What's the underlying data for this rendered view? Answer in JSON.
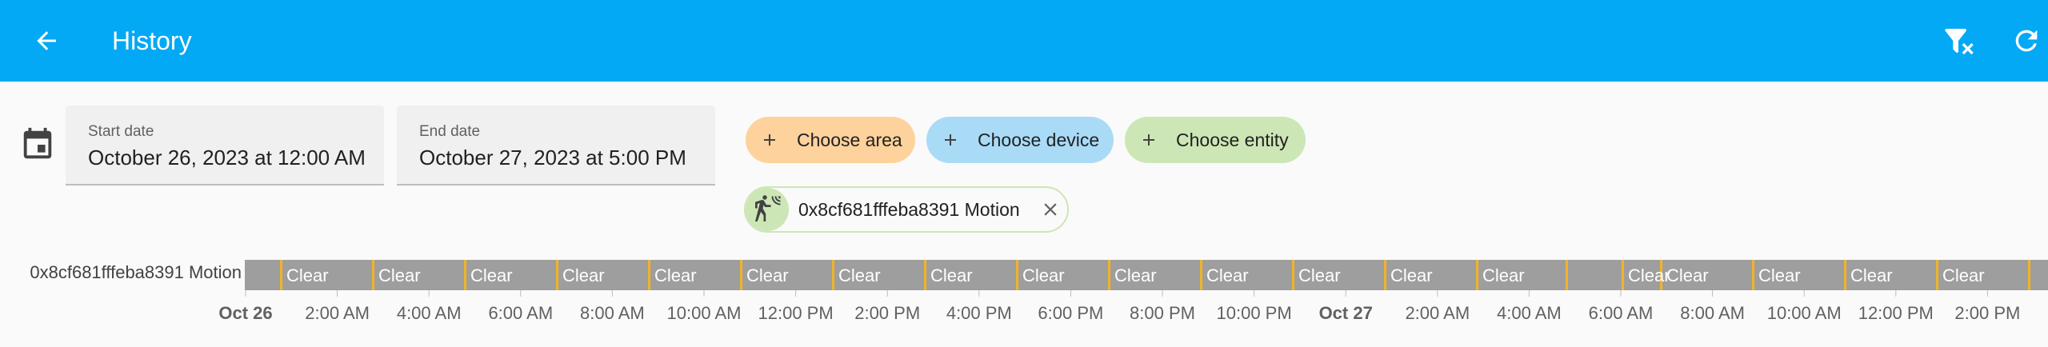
{
  "header": {
    "title": "History"
  },
  "filters": {
    "start_date": {
      "label": "Start date",
      "value": "October 26, 2023 at 12:00 AM"
    },
    "end_date": {
      "label": "End date",
      "value": "October 27, 2023 at 5:00 PM"
    }
  },
  "chips": {
    "area": "Choose area",
    "device": "Choose device",
    "entity": "Choose entity"
  },
  "selected_entity": {
    "name": "0x8cf681fffeba8391 Motion"
  },
  "timeline": {
    "entity_label": "0x8cf681fffeba8391 Motion",
    "state_label": "Clear",
    "clear_segment_count": 19,
    "ticks": [
      "Oct 26",
      "2:00 AM",
      "4:00 AM",
      "6:00 AM",
      "8:00 AM",
      "10:00 AM",
      "12:00 PM",
      "2:00 PM",
      "4:00 PM",
      "6:00 PM",
      "8:00 PM",
      "10:00 PM",
      "Oct 27",
      "2:00 AM",
      "4:00 AM",
      "6:00 AM",
      "8:00 AM",
      "10:00 AM",
      "12:00 PM",
      "2:00 PM"
    ],
    "bold_ticks": [
      "Oct 26",
      "Oct 27"
    ]
  },
  "colors": {
    "app_bar": "#03a9f4",
    "clear_state": "#9e9e9e",
    "detected_state": "#f0b429"
  },
  "icons": {
    "back": "arrow-left-icon",
    "clear_filter": "filter-remove-icon",
    "refresh": "refresh-icon",
    "calendar": "calendar-icon",
    "plus": "plus-icon",
    "motion": "motion-sensor-icon",
    "close": "close-icon"
  }
}
